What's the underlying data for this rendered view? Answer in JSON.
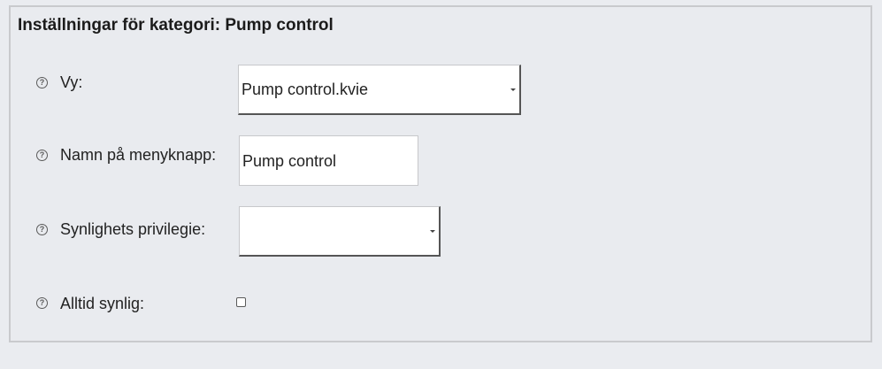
{
  "panel": {
    "title": "Inställningar för kategori: Pump control"
  },
  "fields": {
    "view": {
      "label": "Vy:",
      "value": "Pump control.kvie"
    },
    "menu_button_name": {
      "label": "Namn på menyknapp:",
      "value": "Pump control"
    },
    "visibility_privilege": {
      "label": "Synlighets privilegie:",
      "value": ""
    },
    "always_visible": {
      "label": "Alltid synlig:",
      "checked": false
    }
  },
  "icons": {
    "help": "question-circle-icon",
    "help_glyph": "?"
  }
}
